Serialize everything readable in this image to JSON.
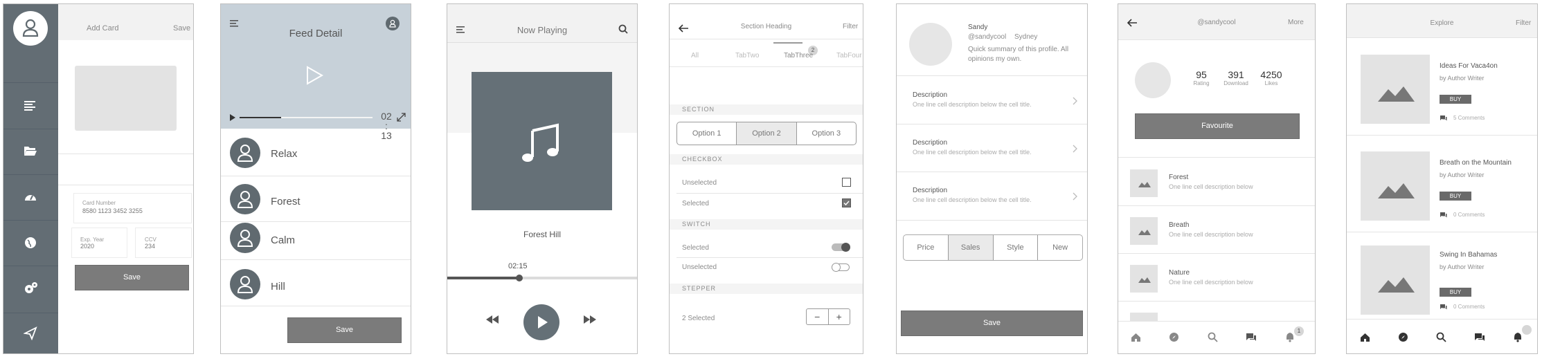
{
  "s1": {
    "title": "Add Card",
    "save_top": "Save",
    "card_number_label": "Card Number",
    "card_number_value": "8580 1123 3452 3255",
    "exp_label": "Exp. Year",
    "exp_value": "2020",
    "ccv_label": "CCV",
    "ccv_value": "234",
    "save_button": "Save"
  },
  "s2": {
    "title": "Feed Detail",
    "time": "02\n:\n13",
    "items": [
      {
        "label": "Relax"
      },
      {
        "label": "Forest"
      },
      {
        "label": "Calm"
      },
      {
        "label": "Hill"
      }
    ],
    "save_button": "Save"
  },
  "s3": {
    "title": "Now Playing",
    "track": "Forest Hill",
    "time": "02:15",
    "progress": 0.38
  },
  "s4": {
    "title": "Section Heading",
    "filter": "Filter",
    "tabs": [
      "All",
      "TabTwo",
      "TabThree",
      "TabFour"
    ],
    "tab_badge": "2",
    "section_label": "SECTION",
    "options": [
      "Option 1",
      "Option 2",
      "Option 3"
    ],
    "checkbox_label": "CHECKBOX",
    "unselected": "Unselected",
    "selected": "Selected",
    "switch_label": "SWITCH",
    "switch_selected": "Selected",
    "switch_unselected": "Unselected",
    "stepper_label": "STEPPER",
    "stepper_value": "2 Selected",
    "minus": "−",
    "plus": "+"
  },
  "s5": {
    "name": "Sandy",
    "handle": "@sandycool",
    "city": "Sydney",
    "summary": "Quick summary of this profile. All opinions my own.",
    "rows": [
      {
        "title": "Description",
        "sub": "One line cell description below the cell title."
      },
      {
        "title": "Description",
        "sub": "One line cell description below the cell title."
      },
      {
        "title": "Description",
        "sub": "One line cell description below the cell title."
      }
    ],
    "segments": [
      "Price",
      "Sales",
      "Style",
      "New"
    ],
    "save_button": "Save"
  },
  "s6": {
    "title": "@sandycool",
    "more": "More",
    "stats": [
      {
        "value": "95",
        "label": "Rating"
      },
      {
        "value": "391",
        "label": "Download"
      },
      {
        "value": "4250",
        "label": "Likes"
      }
    ],
    "favourite": "Favourite",
    "items": [
      {
        "title": "Forest",
        "sub": "One line cell description below"
      },
      {
        "title": "Breath",
        "sub": "One line cell description below"
      },
      {
        "title": "Nature",
        "sub": "One line cell description below"
      }
    ],
    "bell_badge": "1"
  },
  "s7": {
    "title": "Explore",
    "filter": "Filter",
    "items": [
      {
        "title": "Ideas For Vaca4on",
        "author": "by Author Writer",
        "buy": "BUY",
        "comments": "5 Comments"
      },
      {
        "title": "Breath on the Mountain",
        "author": "by Author Writer",
        "buy": "BUY",
        "comments": "0 Comments"
      },
      {
        "title": "Swing In Bahamas",
        "author": "by Author Writer",
        "buy": "BUY",
        "comments": "0 Comments"
      }
    ]
  }
}
